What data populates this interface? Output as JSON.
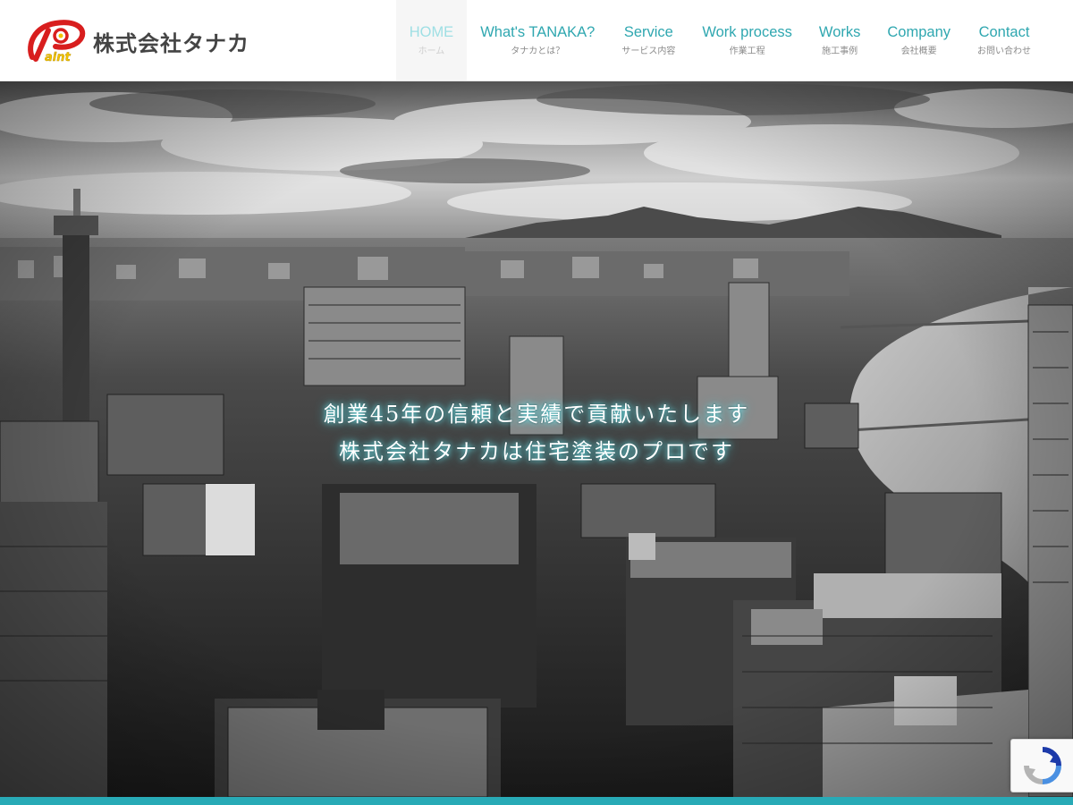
{
  "header": {
    "logo_mark_text": "Paint",
    "company_name": "株式会社タナカ"
  },
  "nav": {
    "items": [
      {
        "en": "HOME",
        "jp": "ホーム",
        "active": true
      },
      {
        "en": "What's TANAKA?",
        "jp": "タナカとは？"
      },
      {
        "en": "Service",
        "jp": "サービス内容"
      },
      {
        "en": "Work process",
        "jp": "作業工程"
      },
      {
        "en": "Works",
        "jp": "施工事例"
      },
      {
        "en": "Company",
        "jp": "会社概要"
      },
      {
        "en": "Contact",
        "jp": "お問い合わせ"
      }
    ]
  },
  "hero": {
    "line1": "創業45年の信頼と実績で貢献いたします",
    "line2": "株式会社タナカは住宅塗装のプロです"
  },
  "colors": {
    "accent": "#2fa7b0",
    "bottom_bar": "#28aab6",
    "logo_red": "#d81e1e",
    "logo_yellow": "#f2c300"
  },
  "icons": {
    "recaptcha": "recaptcha-icon"
  }
}
